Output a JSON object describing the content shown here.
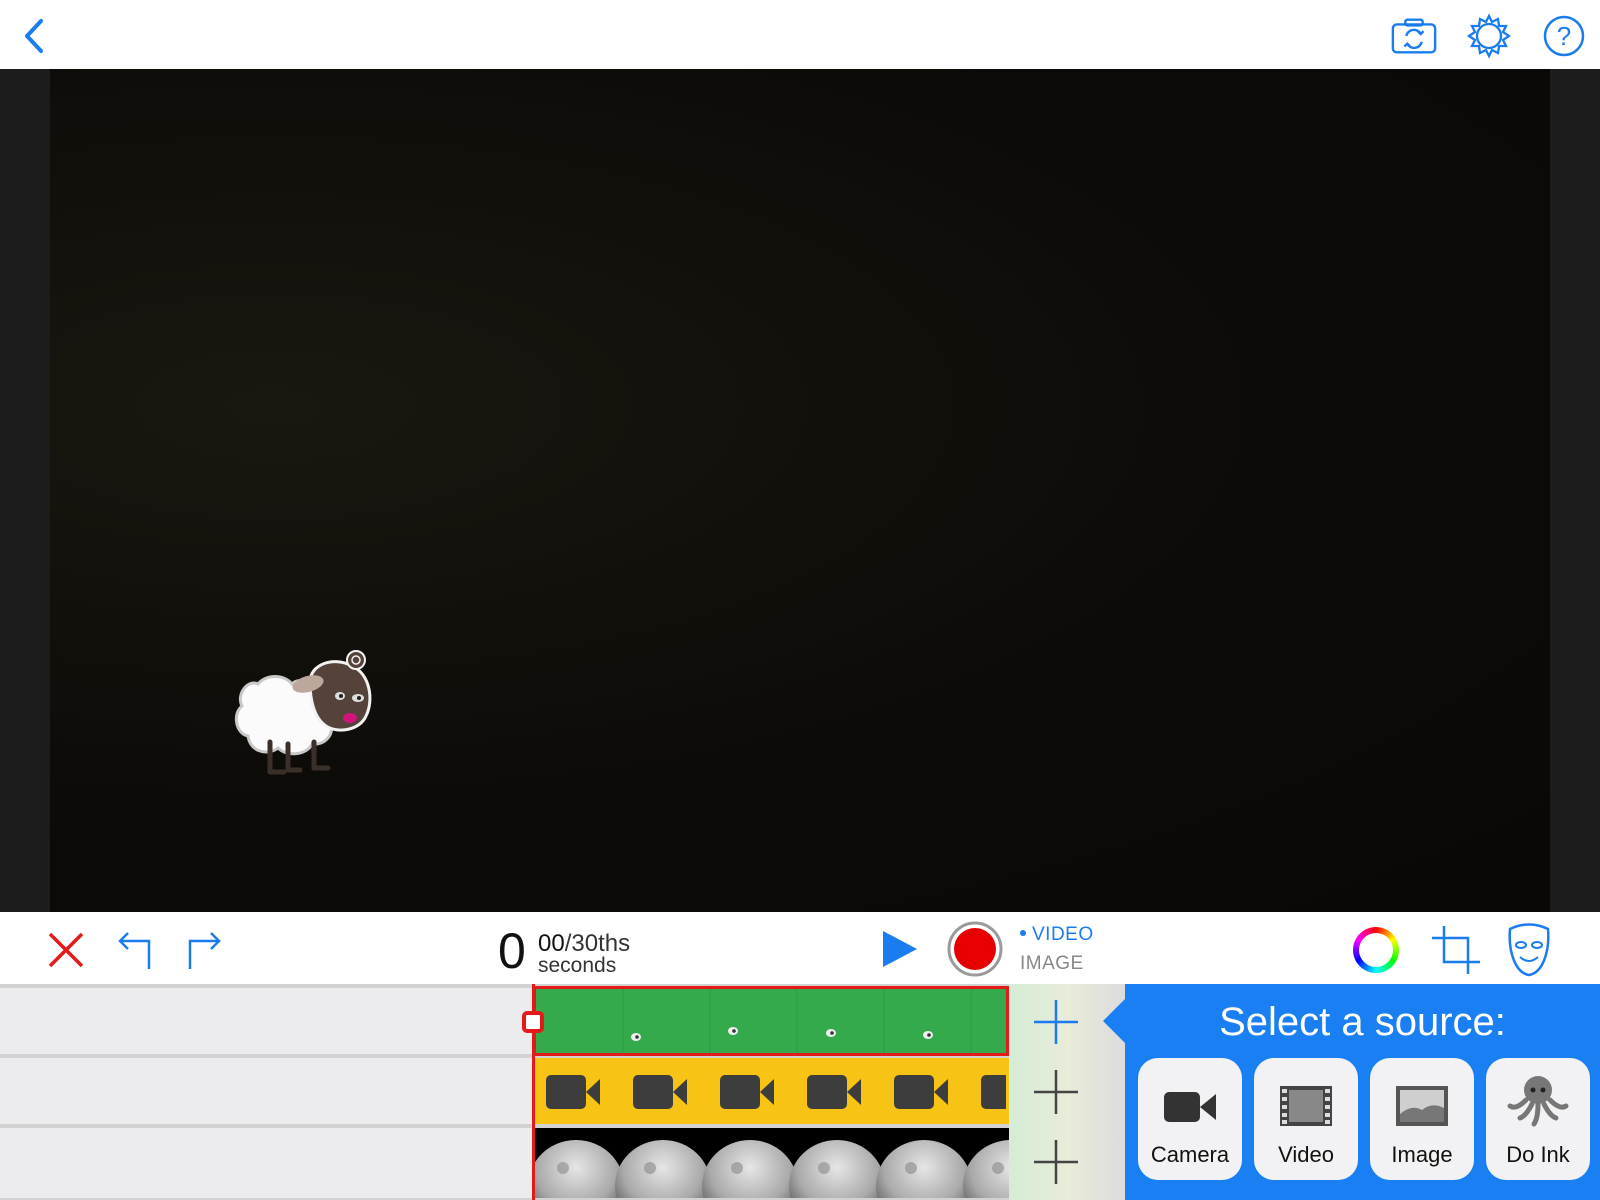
{
  "topbar": {
    "back_icon": "chevron-left-icon",
    "camera_switch_icon": "camera-switch-icon",
    "settings_icon": "gear-icon",
    "help_icon": "help-icon"
  },
  "toolbar": {
    "time_seconds": "0",
    "time_frames": "00",
    "time_fraction_label": "/30ths",
    "time_unit": "seconds",
    "mode_video": "VIDEO",
    "mode_image": "IMAGE",
    "selected_mode": "VIDEO",
    "icons": [
      "close-icon",
      "undo-icon",
      "redo-icon",
      "play-icon",
      "record-icon",
      "color-wheel-icon",
      "crop-icon",
      "mask-icon"
    ]
  },
  "source_panel": {
    "title": "Select a source:",
    "options": [
      {
        "label": "Camera",
        "icon": "video-camera-icon"
      },
      {
        "label": "Video",
        "icon": "film-strip-icon"
      },
      {
        "label": "Image",
        "icon": "image-icon"
      },
      {
        "label": "Do Ink",
        "icon": "octopus-icon"
      }
    ]
  },
  "colors": {
    "accent": "#1a7ff2",
    "record": "#e60000",
    "delete": "#e41a1a",
    "green_track": "#34aa4c",
    "yellow_track": "#f7c416"
  }
}
